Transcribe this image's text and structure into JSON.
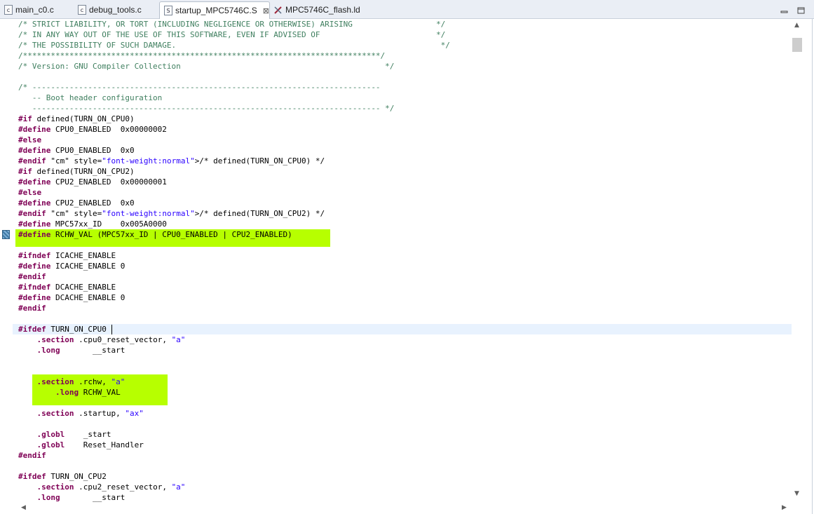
{
  "tabs": [
    {
      "label": "main_c0.c",
      "icon": "c-file-icon",
      "active": false
    },
    {
      "label": "debug_tools.c",
      "icon": "c-file-icon",
      "active": false
    },
    {
      "label": "startup_MPC5746C.S",
      "icon": "asm-file-icon",
      "active": true,
      "close": "⊠"
    },
    {
      "label": "MPC5746C_flash.ld",
      "icon": "linker-file-icon",
      "active": false
    }
  ],
  "icon_glyphs": {
    "c_file": "c",
    "asm_file": "S"
  },
  "code": [
    "/* STRICT LIABILITY, OR TORT (INCLUDING NEGLIGENCE OR OTHERWISE) ARISING                  */",
    "/* IN ANY WAY OUT OF THE USE OF THIS SOFTWARE, EVEN IF ADVISED OF                         */",
    "/* THE POSSIBILITY OF SUCH DAMAGE.                                                         */",
    "/*****************************************************************************/",
    "/* Version: GNU Compiler Collection                                            */",
    "",
    "/* ---------------------------------------------------------------------------",
    "   -- Boot header configuration",
    "   --------------------------------------------------------------------------- */",
    "#if defined(TURN_ON_CPU0)",
    "#define CPU0_ENABLED  0x00000002",
    "#else",
    "#define CPU0_ENABLED  0x0",
    "#endif /* defined(TURN_ON_CPU0) */",
    "#if defined(TURN_ON_CPU2)",
    "#define CPU2_ENABLED  0x00000001",
    "#else",
    "#define CPU2_ENABLED  0x0",
    "#endif /* defined(TURN_ON_CPU2) */",
    "#define MPC57xx_ID    0x005A0000",
    "#define RCHW_VAL (MPC57xx_ID | CPU0_ENABLED | CPU2_ENABLED)",
    "",
    "#ifndef ICACHE_ENABLE",
    "#define ICACHE_ENABLE 0",
    "#endif",
    "#ifndef DCACHE_ENABLE",
    "#define DCACHE_ENABLE 0",
    "#endif",
    "",
    "#ifdef TURN_ON_CPU0",
    "    .section .cpu0_reset_vector, \"a\"",
    "    .long       __start",
    "",
    "",
    "    .section .rchw, \"a\"",
    "        .long RCHW_VAL",
    "",
    "    .section .startup, \"ax\"",
    "",
    "    .globl    _start",
    "    .globl    Reset_Handler",
    "#endif",
    "",
    "#ifdef TURN_ON_CPU2",
    "    .section .cpu2_reset_vector, \"a\"",
    "    .long       __start"
  ],
  "colors": {
    "comment": "#3f7f5f",
    "keyword": "#7f0055",
    "string": "#2a00ff",
    "highlight": "#b7ff00",
    "current_line": "#e8f2fe"
  }
}
